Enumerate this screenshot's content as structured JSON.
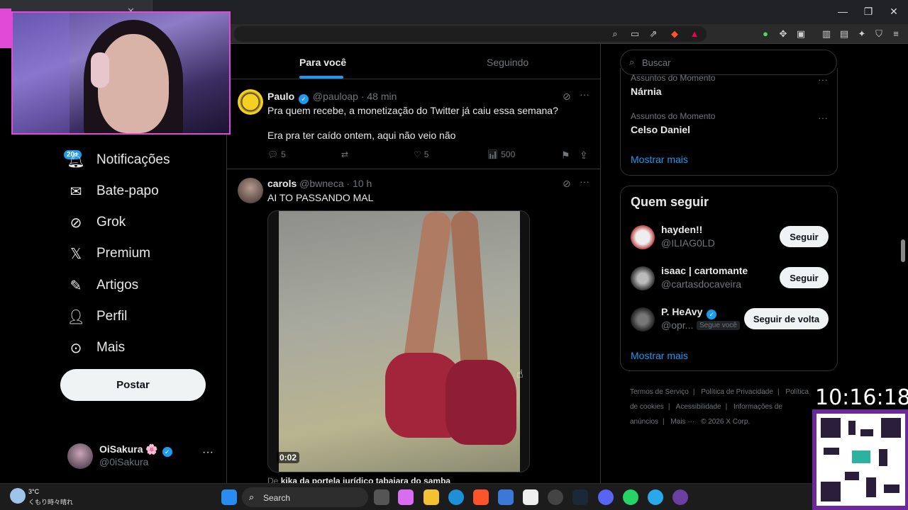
{
  "timeline": {
    "tabs": [
      "Para você",
      "Seguindo"
    ],
    "tweets": [
      {
        "name": "Paulo",
        "handle": "@pauloap",
        "time": "· 48 min",
        "lines": [
          "Pra quem recebe, a monetização do Twitter já caiu essa semana?",
          "Era pra ter caído ontem, aqui não veio não"
        ],
        "replies": "5",
        "likes": "5",
        "views": "500"
      },
      {
        "name": "carols",
        "handle": "@bwneca",
        "time": "· 10 h",
        "text": "AI TO PASSANDO MAL",
        "video_time": "0:02",
        "caption_prefix": "De",
        "caption_source": "kika da portela jurídico tabajara do samba"
      }
    ]
  },
  "nav": {
    "badge": "20+",
    "items": [
      "Notificações",
      "Bate-papo",
      "Grok",
      "Premium",
      "Artigos",
      "Perfil",
      "Mais"
    ],
    "post_label": "Postar",
    "account_name": "OiSakura 🌸",
    "account_handle": "@0iSakura"
  },
  "sidebar": {
    "search_placeholder": "Buscar",
    "trends": [
      {
        "category": "Assuntos do Momento",
        "name": "Nárnia"
      },
      {
        "category": "Assuntos do Momento",
        "name": "Celso Daniel"
      }
    ],
    "trends_more": "Mostrar mais",
    "who_to_follow_title": "Quem seguir",
    "suggestions": [
      {
        "name": "hayden!!",
        "handle": "@ILIAG0LD",
        "button": "Seguir"
      },
      {
        "name": "isaac | cartomante",
        "handle": "@cartasdocaveira",
        "button": "Seguir"
      },
      {
        "name": "P. HeAvy",
        "handle": "@opr...",
        "follows_you": "Segue você",
        "button": "Seguir de volta"
      }
    ],
    "follow_more": "Mostrar mais",
    "footer": [
      "Termos de Serviço",
      "|",
      "Política de Privacidade",
      "|",
      "Política de cookies",
      "|",
      "Acessibilidade",
      "|",
      "Informações de anúncios",
      "|",
      "Mais ···",
      "© 2026 X Corp."
    ]
  },
  "overlay": {
    "clock": "10:16:18"
  },
  "taskbar": {
    "temperature": "3°C",
    "weather": "くもり時々晴れ",
    "search_label": "Search"
  },
  "colors": {
    "accent": "#1d9bf0",
    "background": "#000000",
    "webcam_border": "#e04ad6"
  }
}
